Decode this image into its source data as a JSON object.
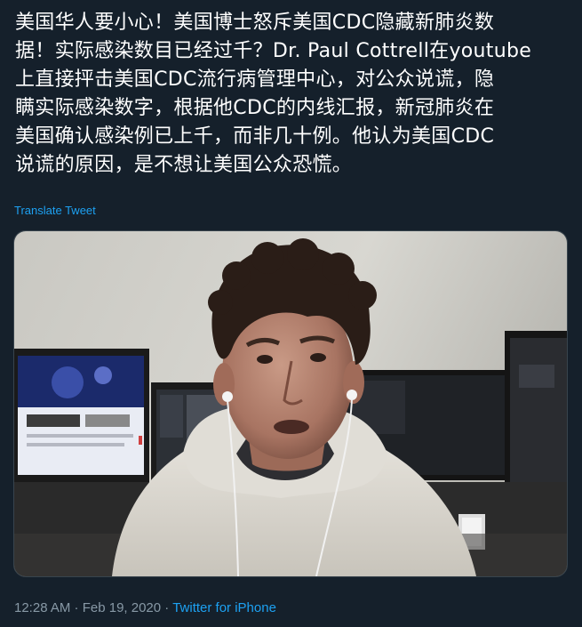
{
  "tweet": {
    "text": "美国华人要小心！美国博士怒斥美国CDC隐藏新肺炎数\n据！实际感染数目已经过千？Dr. Paul Cottrell在youtube\n上直接抨击美国CDC流行病管理中心，对公众说谎，隐\n瞒实际感染数字，根据他CDC的内线汇报，新冠肺炎在\n美国确认感染例已上千，而非几十例。他认为美国CDC\n说谎的原因，是不想让美国公众恐慌。",
    "translate_label": "Translate Tweet",
    "timestamp": "12:28 AM · Feb 19, 2020",
    "separator": " · ",
    "source": "Twitter for iPhone"
  },
  "colors": {
    "background": "#15202b",
    "text": "#ffffff",
    "link": "#1da1f2",
    "muted": "#8899a6",
    "border": "#38444d"
  }
}
